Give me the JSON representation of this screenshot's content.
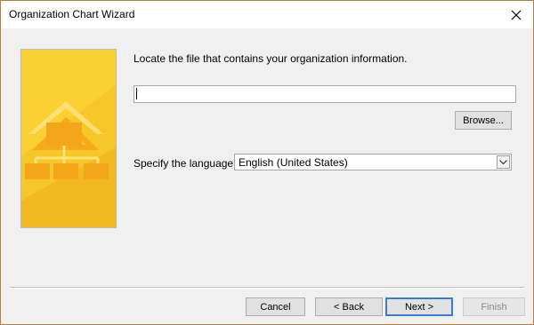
{
  "window": {
    "title": "Organization Chart Wizard",
    "close_icon": "close-icon",
    "border_color": "#c07a3f"
  },
  "banner": {
    "image": "org-chart-wizard-banner",
    "color": "#f7c72a"
  },
  "file_section": {
    "prompt": "Locate the file that contains your organization information.",
    "file_value": "",
    "browse_label": "Browse..."
  },
  "language": {
    "label": "Specify the language:",
    "selected": "English (United States)",
    "dropdown_icon": "chevron-down-icon"
  },
  "buttons": {
    "cancel": "Cancel",
    "back": "< Back",
    "next": "Next >",
    "finish": "Finish"
  }
}
